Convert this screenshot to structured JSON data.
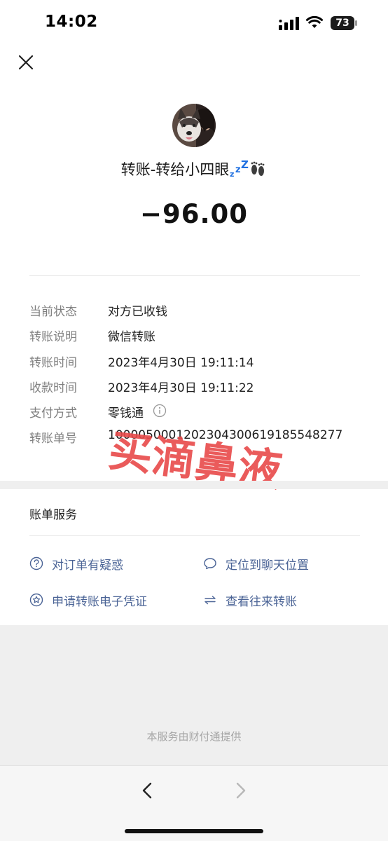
{
  "status_bar": {
    "time": "14:02",
    "battery": "73"
  },
  "header": {
    "close_icon": "close-icon"
  },
  "payee": {
    "avatar_icon": "avatar-photo",
    "title": "转账-转给小四眼",
    "emojis": [
      "sleeping-zzz-emoji",
      "footprints-emoji"
    ]
  },
  "amount": "−96.00",
  "details": [
    {
      "label": "当前状态",
      "value": "对方已收钱"
    },
    {
      "label": "转账说明",
      "value": "微信转账"
    },
    {
      "label": "转账时间",
      "value": "2023年4月30日 19:11:14"
    },
    {
      "label": "收款时间",
      "value": "2023年4月30日 19:11:22"
    },
    {
      "label": "支付方式",
      "value": "零钱通",
      "icon": "info-icon"
    },
    {
      "label": "转账单号",
      "value": "1000050001202304300619185548277"
    }
  ],
  "watermark": "买滴鼻液",
  "services": {
    "title": "账单服务",
    "items": [
      {
        "label": "对订单有疑惑",
        "icon": "question-icon"
      },
      {
        "label": "定位到聊天位置",
        "icon": "chat-bubble-icon"
      },
      {
        "label": "申请转账电子凭证",
        "icon": "star-badge-icon"
      },
      {
        "label": "查看往来转账",
        "icon": "swap-arrows-icon"
      }
    ]
  },
  "footer": "本服务由财付通提供",
  "nav": {
    "back_icon": "chevron-left-icon",
    "forward_icon": "chevron-right-icon"
  },
  "colors": {
    "link": "#4b6496",
    "watermark": "#e84a4a",
    "label": "#808080"
  }
}
